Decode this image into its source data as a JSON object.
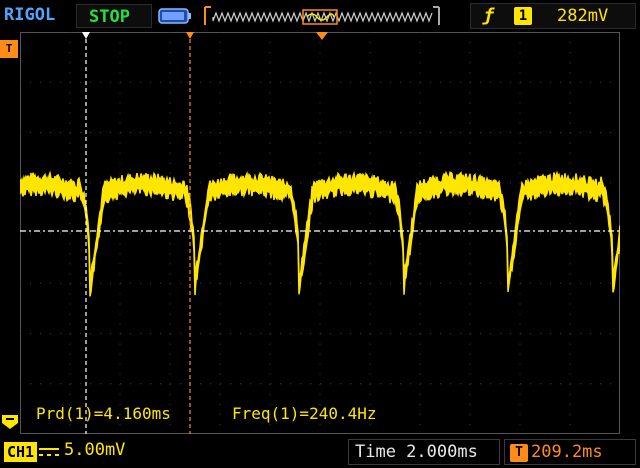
{
  "header": {
    "brand": "RIGOL",
    "run_state": "STOP",
    "trigger": {
      "edge_icon": "rising-edge-icon",
      "channel": "1",
      "level": "282mV"
    }
  },
  "measurements": {
    "period": "Prd(1)=4.160ms",
    "frequency": "Freq(1)=240.4Hz"
  },
  "footer": {
    "channel_badge": "CH1",
    "coupling_icon": "dc-coupling-icon",
    "vertical_scale": "5.00mV",
    "timebase": "Time 2.000ms",
    "trigger_offset_icon": "T",
    "trigger_offset": "209.2ms"
  },
  "markers": {
    "trigger_marker": "T"
  },
  "colors": {
    "trace": "#ffe600",
    "trigger": "#ff8c1a",
    "run_state": "#27e03a",
    "brand": "#4fa6ff",
    "grid": "#3a3a3a"
  },
  "waveform": {
    "channel": "CH1",
    "period_ms": 4.16,
    "cycles_visible": 6
  }
}
